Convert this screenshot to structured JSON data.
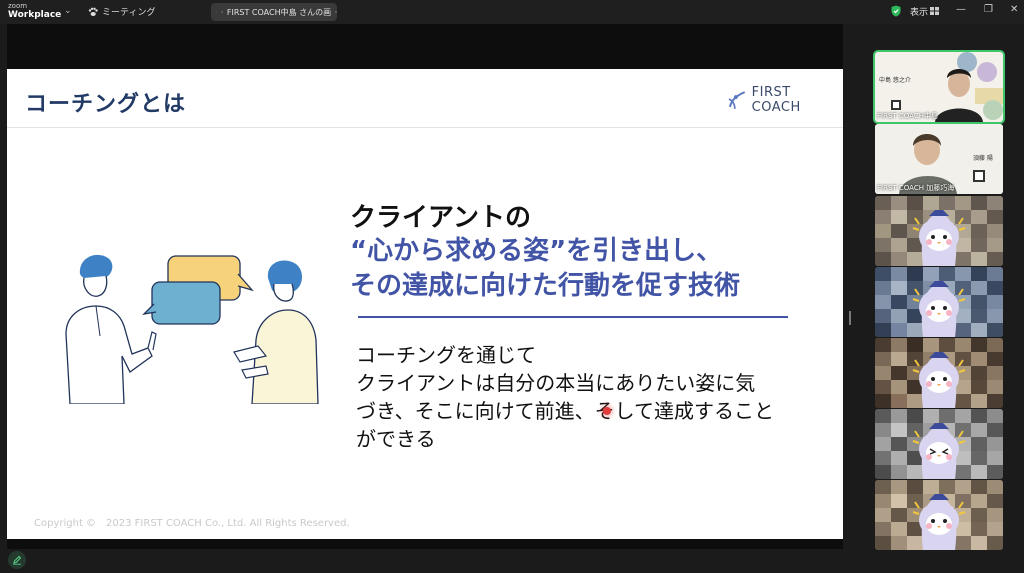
{
  "titlebar": {
    "brand_small": "zoom",
    "brand_name": "Workplace",
    "meeting_label": "ミーティング",
    "share_title": "FIRST COACH中島 さんの画",
    "view_label": "表示"
  },
  "slide": {
    "title": "コーチングとは",
    "logo_text": "FIRST COACH",
    "headline_line1": "クライアントの",
    "headline_line2": "“心から求める姿”を引き出し、",
    "headline_line3": "その達成に向けた行動を促す技術",
    "body_lines": [
      "コーチングを通じて",
      "クライアントは自分の本当にありたい姿に気",
      "づき、そこに向けて前進、そして達成すること",
      "ができる"
    ],
    "copyright": "Copyright ©　2023 FIRST COACH Co., Ltd. All Rights Reserved."
  },
  "participants": [
    {
      "name": "FIRST COACH中島",
      "type": "camera",
      "active": true
    },
    {
      "name": "FIRST COACH 加藤巧海",
      "type": "camera",
      "active": false
    },
    {
      "name": "",
      "type": "avatar",
      "active": false
    },
    {
      "name": "",
      "type": "avatar",
      "active": false
    },
    {
      "name": "",
      "type": "avatar",
      "active": false
    },
    {
      "name": "",
      "type": "avatar",
      "active": false
    },
    {
      "name": "",
      "type": "avatar",
      "active": false
    }
  ],
  "colors": {
    "accent_blue": "#4254a6",
    "title_navy": "#223a66",
    "active_border": "#3fc56a"
  }
}
